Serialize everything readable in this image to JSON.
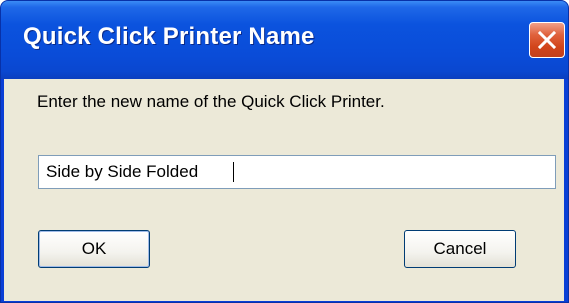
{
  "dialog": {
    "title": "Quick Click Printer Name",
    "prompt": "Enter the new name of the Quick Click Printer.",
    "name_value": "Side by Side Folded",
    "ok_label": "OK",
    "cancel_label": "Cancel"
  },
  "icons": {
    "close": "close-icon"
  },
  "colors": {
    "titlebar": "#0a4cd8",
    "close_button": "#d2451b",
    "client_bg": "#ece9d8",
    "input_border": "#7f9db9",
    "button_border": "#003c74"
  }
}
